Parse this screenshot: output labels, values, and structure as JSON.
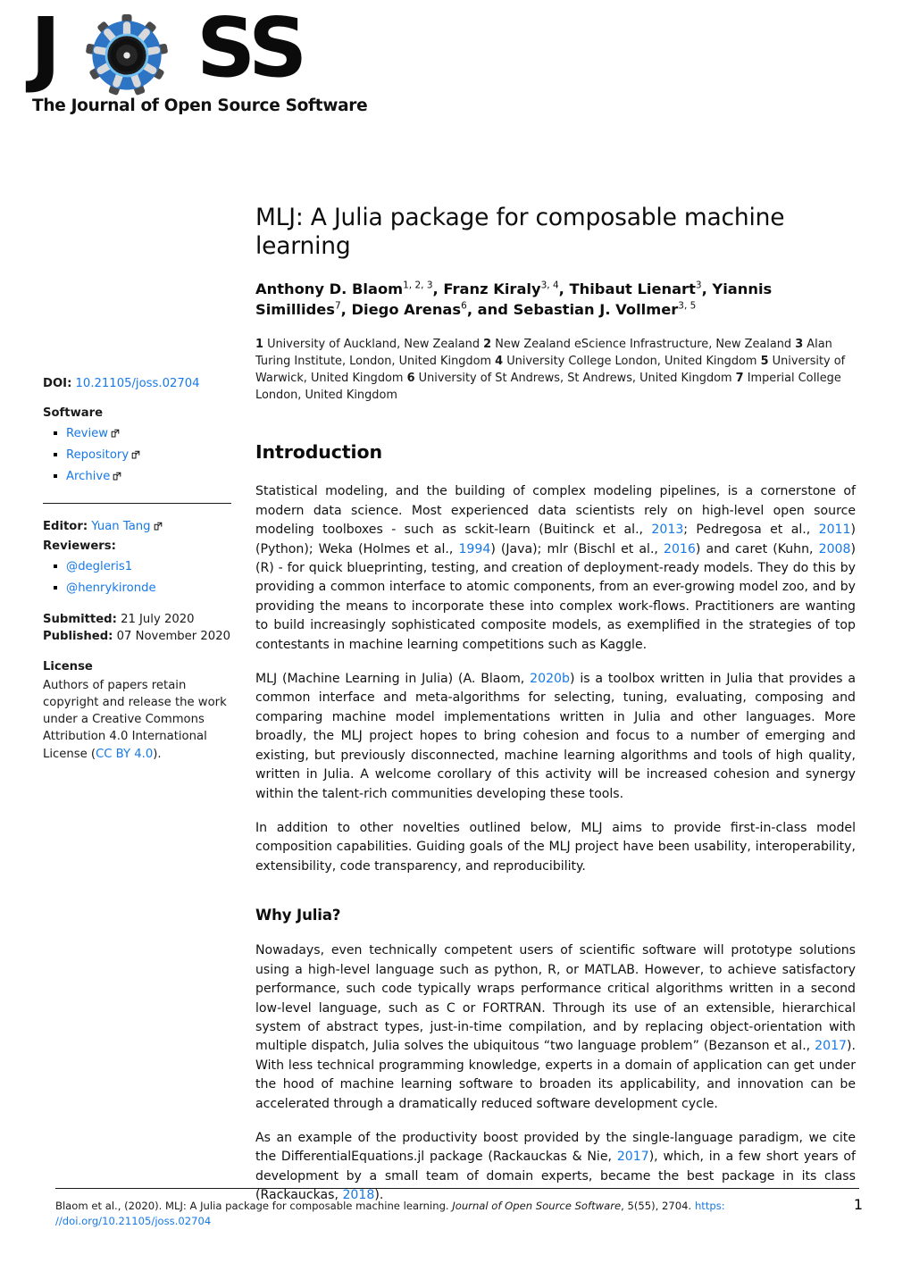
{
  "logo": {
    "letters": {
      "j": "J",
      "s1": "S",
      "s2": "S"
    },
    "tagline": "The Journal of Open Source Software",
    "gear_color": "#2d74c4",
    "gear_dark": "#3a3a3a"
  },
  "sidebar": {
    "doi_label": "DOI:",
    "doi_value": "10.21105/joss.02704",
    "software_heading": "Software",
    "software_links": [
      {
        "label": "Review",
        "icon": "external-link-icon"
      },
      {
        "label": "Repository",
        "icon": "external-link-icon"
      },
      {
        "label": "Archive",
        "icon": "external-link-icon"
      }
    ],
    "editor_label": "Editor:",
    "editor_name": "Yuan Tang",
    "editor_icon": "external-link-icon",
    "reviewers_label": "Reviewers:",
    "reviewers": [
      "@degleris1",
      "@henrykironde"
    ],
    "submitted_label": "Submitted:",
    "submitted_date": "21 July 2020",
    "published_label": "Published:",
    "published_date": "07 November 2020",
    "license_heading": "License",
    "license_text_before": "Authors of papers retain copyright and release the work under a Creative Commons Attribution 4.0 International License (",
    "license_link": "CC BY 4.0",
    "license_text_after": ")."
  },
  "paper": {
    "title": "MLJ: A Julia package for composable machine learning",
    "authors_line1_a": "Anthony D. Blaom",
    "authors_sup1": "1, 2, 3",
    "authors_line1_b": ", Franz Kiraly",
    "authors_sup2": "3, 4",
    "authors_line1_c": ", Thibaut Lienart",
    "authors_sup3": "3",
    "authors_line1_d": ", Yiannis",
    "authors_line2_a": "Simillides",
    "authors_sup4": "7",
    "authors_line2_b": ", Diego Arenas",
    "authors_sup5": "6",
    "authors_line2_c": ", and Sebastian J. Vollmer",
    "authors_sup6": "3, 5",
    "affiliations": [
      {
        "num": "1",
        "text": " University of Auckland, New Zealand "
      },
      {
        "num": "2",
        "text": " New Zealand eScience Infrastructure, New Zealand "
      },
      {
        "num": "3",
        "text": " Alan Turing Institute, London, United Kingdom "
      },
      {
        "num": "4",
        "text": " University College London, United Kingdom "
      },
      {
        "num": "5",
        "text": " University of Warwick, United Kingdom "
      },
      {
        "num": "6",
        "text": " University of St Andrews, St Andrews, United Kingdom "
      },
      {
        "num": "7",
        "text": " Imperial College London, United Kingdom"
      }
    ],
    "sections": {
      "introduction_heading": "Introduction",
      "why_julia_heading": "Why Julia?"
    },
    "paragraphs": {
      "intro_p1_a": "Statistical modeling, and the building of complex modeling pipelines, is a cornerstone of modern data science. Most experienced data scientists rely on high-level open source modeling toolboxes - such as sckit-learn (Buitinck et al., ",
      "intro_p1_cite1": "2013",
      "intro_p1_b": "; Pedregosa et al., ",
      "intro_p1_cite2": "2011",
      "intro_p1_c": ") (Python); Weka (Holmes et al., ",
      "intro_p1_cite3": "1994",
      "intro_p1_d": ") (Java); mlr (Bischl et al., ",
      "intro_p1_cite4": "2016",
      "intro_p1_e": ") and caret (Kuhn, ",
      "intro_p1_cite5": "2008",
      "intro_p1_f": ") (R) - for quick blueprinting, testing, and creation of deployment-ready models. They do this by providing a common interface to atomic components, from an ever-growing model zoo, and by providing the means to incorporate these into complex work-flows. Practitioners are wanting to build increasingly sophisticated composite models, as exemplified in the strategies of top contestants in machine learning competitions such as Kaggle.",
      "intro_p2_a": "MLJ (Machine Learning in Julia) (A. Blaom, ",
      "intro_p2_cite1": "2020b",
      "intro_p2_b": ") is a toolbox written in Julia that provides a common interface and meta-algorithms for selecting, tuning, evaluating, composing and comparing machine model implementations written in Julia and other languages. More broadly, the MLJ project hopes to bring cohesion and focus to a number of emerging and existing, but previously disconnected, machine learning algorithms and tools of high quality, written in Julia. A welcome corollary of this activity will be increased cohesion and synergy within the talent-rich communities developing these tools.",
      "intro_p3": "In addition to other novelties outlined below, MLJ aims to provide first-in-class model composition capabilities. Guiding goals of the MLJ project have been usability, interoperability, extensibility, code transparency, and reproducibility.",
      "julia_p1_a": "Nowadays, even technically competent users of scientific software will prototype solutions using a high-level language such as python, R, or MATLAB. However, to achieve satisfactory performance, such code typically wraps performance critical algorithms written in a second low-level language, such as C or FORTRAN. Through its use of an extensible, hierarchical system of abstract types, just-in-time compilation, and by replacing object-orientation with multiple dispatch, Julia solves the ubiquitous “two language problem” (Bezanson et al., ",
      "julia_p1_cite1": "2017",
      "julia_p1_b": "). With less technical programming knowledge, experts in a domain of application can get under the hood of machine learning software to broaden its applicability, and innovation can be accelerated through a dramatically reduced software development cycle.",
      "julia_p2_a": "As an example of the productivity boost provided by the single-language paradigm, we cite the DifferentialEquations.jl package (Rackauckas & Nie, ",
      "julia_p2_cite1": "2017",
      "julia_p2_b": "), which, in a few short years of development by a small team of domain experts, became the best package in its class (Rackauckas, ",
      "julia_p2_cite2": "2018",
      "julia_p2_c": ")."
    }
  },
  "footer": {
    "citation_a": "Blaom et al., (2020). MLJ: A Julia package for composable machine learning. ",
    "journal": "Journal of Open Source Software",
    "citation_b": ", 5(55), 2704. ",
    "url_part1": "https:",
    "url_part2": "//doi.org/10.21105/joss.02704",
    "page_number": "1"
  }
}
